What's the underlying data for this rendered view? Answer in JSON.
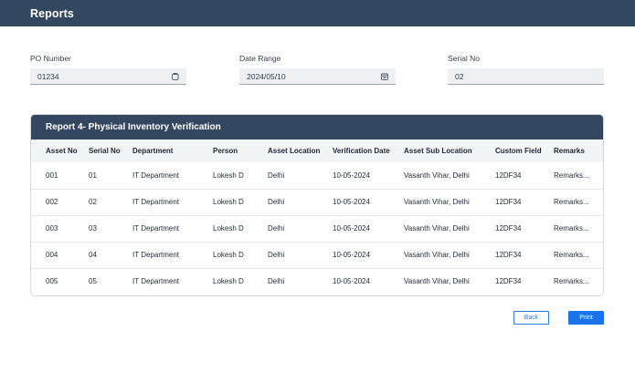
{
  "header": {
    "title": "Reports"
  },
  "filters": {
    "po_number": {
      "label": "PO Number",
      "value": "01234"
    },
    "date_range": {
      "label": "Date Range",
      "value": "2024/05/10"
    },
    "serial_no": {
      "label": "Serial No",
      "value": "02"
    }
  },
  "report": {
    "title": "Report 4- Physical Inventory Verification",
    "columns": [
      "Asset No",
      "Serial No",
      "Department",
      "Person",
      "Asset Location",
      "Verification Date",
      "Asset Sub Location",
      "Custom Field",
      "Remarks"
    ],
    "rows": [
      [
        "001",
        "01",
        "IT Department",
        "Lokesh D",
        "Delhi",
        "10-05-2024",
        "Vasanth Vihar, Delhi",
        "12DF34",
        "Remarks..."
      ],
      [
        "002",
        "02",
        "IT Department",
        "Lokesh D",
        "Delhi",
        "10-05-2024",
        "Vasanth Vihar, Delhi",
        "12DF34",
        "Remarks..."
      ],
      [
        "003",
        "03",
        "IT Department",
        "Lokesh D",
        "Delhi",
        "10-05-2024",
        "Vasanth Vihar, Delhi",
        "12DF34",
        "Remarks..."
      ],
      [
        "004",
        "04",
        "IT Department",
        "Lokesh D",
        "Delhi",
        "10-05-2024",
        "Vasanth Vihar, Delhi",
        "12DF34",
        "Remarks..."
      ],
      [
        "005",
        "05",
        "IT Department",
        "Lokesh D",
        "Delhi",
        "10-05-2024",
        "Vasanth Vihar, Delhi",
        "12DF34",
        "Remarks..."
      ]
    ]
  },
  "actions": {
    "back_label": "Back",
    "print_label": "Print"
  },
  "icons": {
    "po_field_icon": "copy-icon",
    "date_field_icon": "calendar-icon"
  },
  "colors": {
    "header_bg": "#344760",
    "primary": "#1a73e8"
  }
}
